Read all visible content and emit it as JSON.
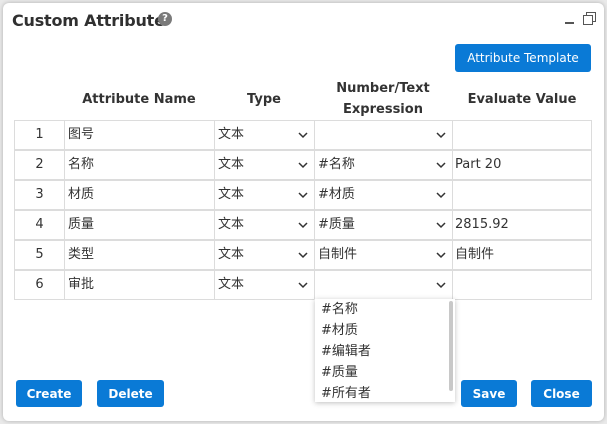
{
  "dialog": {
    "title": "Custom Attribute",
    "help_icon_glyph": "?"
  },
  "toolbar": {
    "template_label": "Attribute Template"
  },
  "table": {
    "headers": {
      "name": "Attribute Name",
      "type": "Type",
      "expr_line1": "Number/Text",
      "expr_line2": "Expression",
      "value": "Evaluate Value"
    },
    "rows": [
      {
        "idx": "1",
        "name": "图号",
        "type": "文本",
        "expr": "",
        "value": ""
      },
      {
        "idx": "2",
        "name": "名称",
        "type": "文本",
        "expr": "#名称",
        "value": "Part 20"
      },
      {
        "idx": "3",
        "name": "材质",
        "type": "文本",
        "expr": "#材质",
        "value": ""
      },
      {
        "idx": "4",
        "name": "质量",
        "type": "文本",
        "expr": "#质量",
        "value": "2815.92"
      },
      {
        "idx": "5",
        "name": "类型",
        "type": "文本",
        "expr": "自制件",
        "value": "自制件"
      },
      {
        "idx": "6",
        "name": "审批",
        "type": "文本",
        "expr": "",
        "value": ""
      }
    ]
  },
  "dropdown": {
    "options": [
      "#名称",
      "#材质",
      "#编辑者",
      "#质量",
      "#所有者"
    ]
  },
  "footer": {
    "create_label": "Create",
    "delete_label": "Delete",
    "save_label": "Save",
    "close_label": "Close"
  },
  "colors": {
    "accent": "#0a7ad6",
    "border": "#dcdcdc"
  }
}
